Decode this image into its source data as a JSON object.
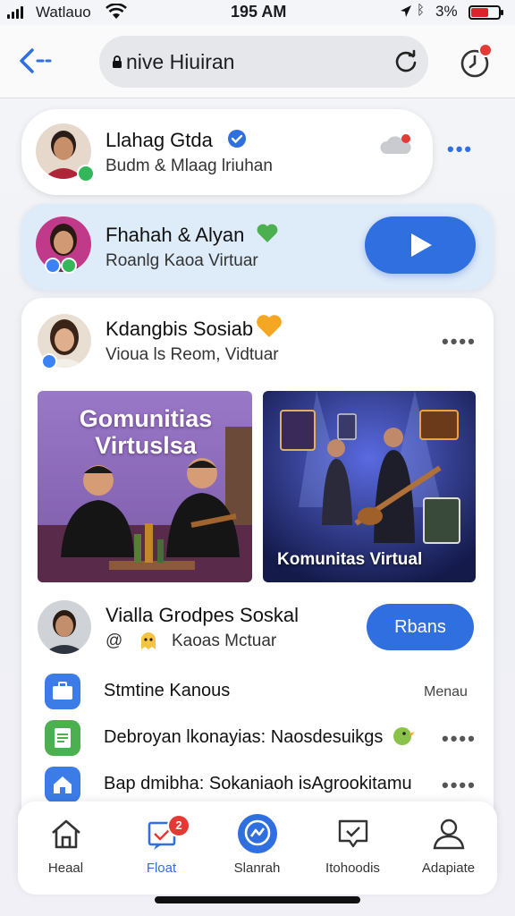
{
  "status_bar": {
    "carrier": "Watlauo",
    "time": "195 AM",
    "battery_text": "3%",
    "battery_level": 0.68
  },
  "browser": {
    "url": "nive Hiuiran"
  },
  "cards": [
    {
      "name": "Llahag Gtda",
      "subtitle": "Budm & Mlaag lriuhan",
      "verified": true
    },
    {
      "name": "Fhahah & Alyan",
      "subtitle": "Roanlg Kaoa Virtuar",
      "heart_color": "#4caf50"
    }
  ],
  "post": {
    "author": "Kdangbis Sosiab",
    "subtitle": "Vioua ls Reom, Vidtuar",
    "image1_title": "Gomunitias Virtuslsa",
    "image2_caption": "Komunitas Virtual",
    "group": {
      "name": "Vialla Grodpes Soskal",
      "subtitle": "Kaoas Mctuar",
      "subtitle_prefix": "@",
      "button": "Rbans"
    },
    "rows": [
      {
        "text": "Stmtine Kanous",
        "right": "Menau",
        "icon": "briefcase-icon",
        "color": "#3b7ce6"
      },
      {
        "text": "Debroyan lkonayias: Naosdesuikgs",
        "right": "",
        "icon": "document-icon",
        "color": "#4caf50"
      },
      {
        "text": "Bap dmibha: Sokaniaoh isAgrookitamu",
        "right": "",
        "icon": "home-icon",
        "color": "#3b7ce6"
      }
    ]
  },
  "tabs": [
    {
      "label": "Heaal",
      "icon": "house-icon",
      "active": false
    },
    {
      "label": "Float",
      "icon": "inbox-icon",
      "active": true,
      "badge": "2"
    },
    {
      "label": "Slanrah",
      "icon": "messenger-icon",
      "active": false
    },
    {
      "label": "Itohoodis",
      "icon": "chat-icon",
      "active": false
    },
    {
      "label": "Adapiate",
      "icon": "profile-icon",
      "active": false
    }
  ],
  "colors": {
    "accent": "#2f6fe0",
    "card_highlight": "#deebf8"
  }
}
